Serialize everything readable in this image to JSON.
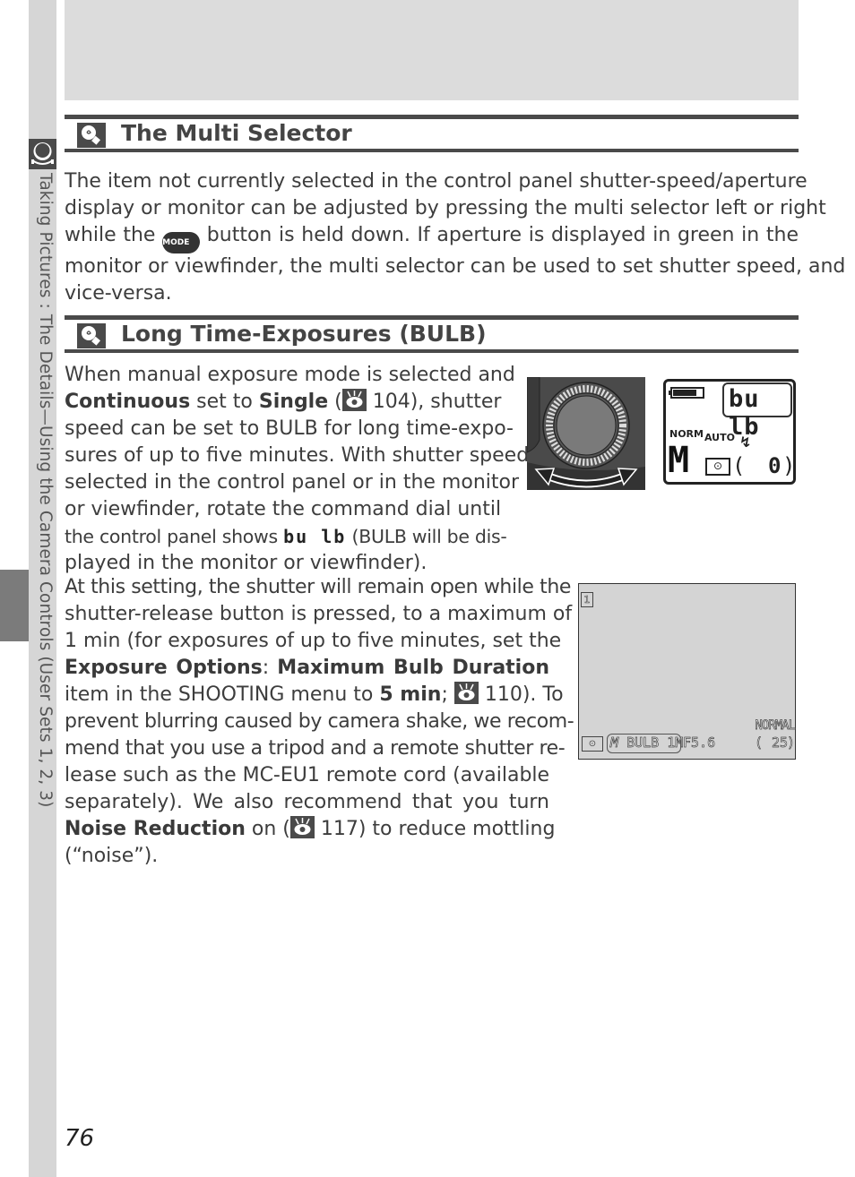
{
  "sidebar": {
    "chapter_label": "Taking Pictures : The Details—Using the Camera Controls (User Sets 1, 2, 3)",
    "icon": "camera-mode-icon"
  },
  "sections": [
    {
      "title": "The Multi Selector",
      "icon": "tip-lightbulb-icon",
      "lines": [
        "The item not currently selected in the control panel shutter-speed/aperture",
        "display or monitor can be adjusted by pressing the multi selector left or right",
        [
          "while the ",
          "{MODE}",
          " button is held down.  If aperture is displayed in green in the"
        ],
        "monitor or viewfinder, the multi selector can be used to set shutter speed, and",
        "vice-versa."
      ],
      "mode_button_label": "MODE"
    },
    {
      "title": "Long Time-Exposures (BULB)",
      "icon": "tip-lightbulb-icon",
      "para1": {
        "l1": "When manual exposure mode is selected and",
        "l2_b1": "Continuous",
        "l2_t1": " set to ",
        "l2_b2": "Single",
        "l2_t2": " (",
        "l2_t3": " 104), shutter",
        "l3": "speed can be set to BULB for long time-expo-",
        "l4": "sures of up to five minutes. With shutter speed",
        "l5": "selected in the control panel or in the monitor",
        "l6": "or viewfinder, rotate the command dial until",
        "l7_t1": "the control panel shows ",
        "l7_seg": "bu lb",
        "l7_t2": " (BULB will be dis-",
        "l8": "played in the monitor or viewfinder)."
      },
      "para2": {
        "l1": "At this setting, the shutter will remain open while the",
        "l2": "shutter-release button is pressed, to a maximum of",
        "l3": "1 min (for exposures of up to five minutes, set the",
        "l4_b1": "Exposure Options",
        "l4_t1": ": ",
        "l4_b2": "Maximum Bulb Duration",
        "l5_t1": "item in the SHOOTING menu to ",
        "l5_b1": "5 min",
        "l5_t2": "; ",
        "l5_t3": " 110). To",
        "l6": "prevent blurring caused by camera shake, we recom-",
        "l7": "mend that you use a tripod and a remote shutter re-",
        "l8": "lease such as the MC-EU1 remote cord (available",
        "l9": "separately). We also recommend that you turn",
        "l10_b1": "Noise Reduction",
        "l10_t1": " on (",
        "l10_t2": " 117) to reduce mottling",
        "l11": "(“noise”)."
      }
    }
  ],
  "figures": {
    "command_dial": {
      "icon": "command-dial-illustration"
    },
    "control_panel": {
      "shutter_display": "bu lb",
      "quality": "NORM",
      "flash_mode": "AUTO",
      "exposure_mode": "M",
      "frames": "0",
      "battery": "battery-full-icon"
    },
    "monitor": {
      "user_set": "1",
      "exposure_mode": "M",
      "shutter": "BULB",
      "bulb_duration": "1M",
      "aperture": "F5.6",
      "quality": "NORMAL",
      "frames": "25"
    }
  },
  "page_number": "76"
}
